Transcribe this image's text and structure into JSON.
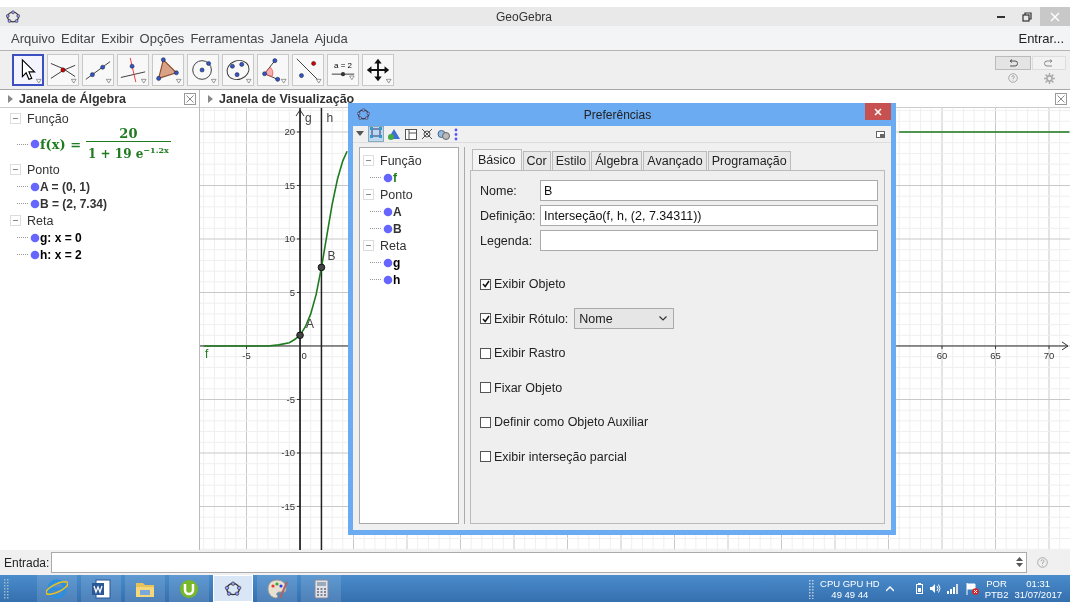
{
  "window": {
    "title": "GeoGebra"
  },
  "menu": [
    "Arquivo",
    "Editar",
    "Exibir",
    "Opções",
    "Ferramentas",
    "Janela",
    "Ajuda"
  ],
  "login": "Entrar...",
  "tools": [
    {
      "kind": "move",
      "selected": true
    },
    {
      "kind": "intersect",
      "selected": false
    },
    {
      "kind": "line",
      "selected": false
    },
    {
      "kind": "perpendicular",
      "selected": false
    },
    {
      "kind": "polygon",
      "selected": false
    },
    {
      "kind": "circle",
      "selected": false
    },
    {
      "kind": "conic",
      "selected": false
    },
    {
      "kind": "angle",
      "selected": false
    },
    {
      "kind": "reflect",
      "selected": false
    },
    {
      "kind": "slider",
      "label": "a = 2",
      "selected": false
    },
    {
      "kind": "pan",
      "selected": false
    }
  ],
  "algebra_view": {
    "title": "Janela de Álgebra",
    "groups": [
      {
        "label": "Função",
        "expanded": true,
        "children": [
          {
            "kind": "formula",
            "color": "#1e7b1e",
            "lhs": "f(x) =",
            "numerator": "20",
            "denominator": "1 + 19 e$^{−1.2x}$"
          }
        ]
      },
      {
        "label": "Ponto",
        "expanded": true,
        "children": [
          {
            "kind": "text",
            "color": "#333333",
            "text": "A = (0, 1)"
          },
          {
            "kind": "text",
            "color": "#333333",
            "text": "B = (2, 7.34)"
          }
        ]
      },
      {
        "label": "Reta",
        "expanded": true,
        "children": [
          {
            "kind": "text",
            "color": "#000000",
            "text": "g: x = 0"
          },
          {
            "kind": "text",
            "color": "#000000",
            "text": "h: x = 2"
          }
        ]
      }
    ]
  },
  "graphics_view": {
    "title": "Janela de Visualização",
    "chart_data": {
      "type": "line",
      "xlim": [
        -9.35,
        71.96
      ],
      "ylim": [
        -19.07,
        22.24
      ],
      "xticks": [
        -5,
        0,
        60,
        65,
        70
      ],
      "yticks": [
        -15,
        -10,
        -5,
        5,
        10,
        15,
        20
      ],
      "grid": true,
      "x": [
        -9,
        -4,
        -3,
        -2,
        -1,
        -0.5,
        0,
        0.5,
        1,
        1.5,
        2,
        2.5,
        3,
        3.5,
        4,
        4.4,
        30,
        56,
        71.9
      ],
      "series": [
        {
          "name": "f",
          "color": "#1e7b1e",
          "values": [
            0,
            0,
            0,
            0.1,
            0.3,
            0.6,
            1,
            1.8,
            3,
            4.8,
            7.3,
            10.3,
            13.2,
            15.6,
            17.3,
            18.2,
            null,
            20,
            20
          ]
        }
      ],
      "ref_lines": [
        {
          "axis": "x",
          "value": 0,
          "label": "g"
        },
        {
          "axis": "x",
          "value": 2,
          "label": "h"
        }
      ],
      "annotations": [
        {
          "text": "A",
          "x": 0,
          "y": 1
        },
        {
          "text": "B",
          "x": 2,
          "y": 7.34
        }
      ]
    }
  },
  "input_bar": {
    "label": "Entrada:"
  },
  "taskbar": {
    "apps": [
      {
        "kind": "browser",
        "selected": false
      },
      {
        "kind": "word",
        "selected": false
      },
      {
        "kind": "folder",
        "selected": false
      },
      {
        "kind": "torrent",
        "selected": false
      },
      {
        "kind": "geogebra",
        "selected": true
      },
      {
        "kind": "paint",
        "selected": false
      },
      {
        "kind": "calculator",
        "selected": false
      }
    ],
    "meter_title": "CPU GPU HD",
    "meter_values": "49  49  44",
    "language": "POR",
    "layout": "PTB2",
    "time": "01:31",
    "date": "31/07/2017"
  },
  "dialog": {
    "title": "Preferências",
    "tree": [
      {
        "label": "Função",
        "children": [
          {
            "text": "f",
            "color": "#1e7b1e"
          }
        ]
      },
      {
        "label": "Ponto",
        "children": [
          {
            "text": "A",
            "color": "#333333"
          },
          {
            "text": "B",
            "color": "#333333"
          }
        ]
      },
      {
        "label": "Reta",
        "children": [
          {
            "text": "g",
            "color": "#000000"
          },
          {
            "text": "h",
            "color": "#000000"
          }
        ]
      }
    ],
    "tabs": [
      {
        "label": "Básico",
        "selected": true
      },
      {
        "label": "Cor",
        "selected": false
      },
      {
        "label": "Estilo",
        "selected": false
      },
      {
        "label": "Álgebra",
        "selected": false
      },
      {
        "label": "Avançado",
        "selected": false
      },
      {
        "label": "Programação",
        "selected": false
      }
    ],
    "fields": [
      {
        "label": "Nome:",
        "value": "B"
      },
      {
        "label": "Definição:",
        "value": "Interseção(f, h, (2, 7.34311))"
      },
      {
        "label": "Legenda:"
      }
    ],
    "options": [
      {
        "label": "Exibir Objeto",
        "checked": true
      },
      {
        "label": "Exibir Rótulo:",
        "checked": true,
        "dropdown": "Nome"
      },
      {
        "label": "Exibir Rastro",
        "checked": false
      },
      {
        "label": "Fixar Objeto",
        "checked": false
      },
      {
        "label": "Definir como Objeto Auxiliar",
        "checked": false
      },
      {
        "label": "Exibir interseção parcial",
        "checked": false
      }
    ]
  }
}
